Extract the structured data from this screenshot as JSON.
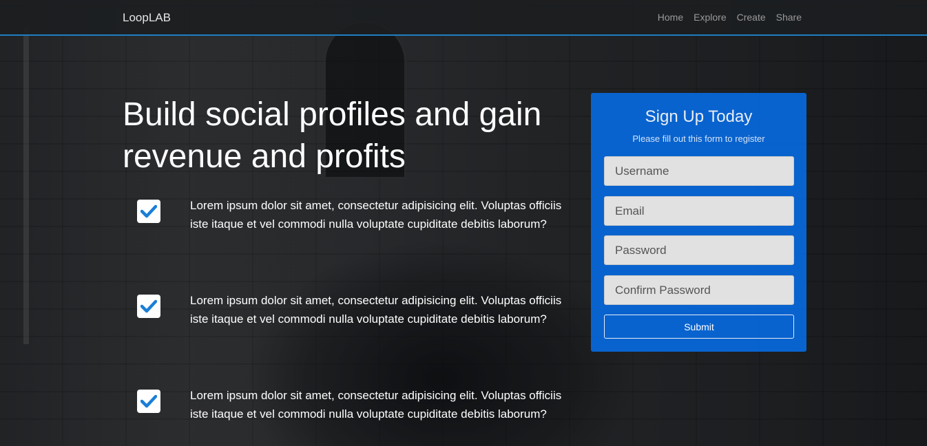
{
  "navbar": {
    "brand": "LoopLAB",
    "links": [
      "Home",
      "Explore",
      "Create",
      "Share"
    ]
  },
  "hero": {
    "title": "Build social profiles and gain revenue and profits",
    "features": [
      "Lorem ipsum dolor sit amet, consectetur adipisicing elit. Voluptas officiis iste itaque et vel commodi nulla voluptate cupiditate debitis laborum?",
      "Lorem ipsum dolor sit amet, consectetur adipisicing elit. Voluptas officiis iste itaque et vel commodi nulla voluptate cupiditate debitis laborum?",
      "Lorem ipsum dolor sit amet, consectetur adipisicing elit. Voluptas officiis iste itaque et vel commodi nulla voluptate cupiditate debitis laborum?"
    ]
  },
  "signup": {
    "title": "Sign Up Today",
    "subtitle": "Please fill out this form to register",
    "fields": {
      "username_placeholder": "Username",
      "email_placeholder": "Email",
      "password_placeholder": "Password",
      "confirm_placeholder": "Confirm Password"
    },
    "submit_label": "Submit"
  },
  "colors": {
    "accent": "#1f7fc4",
    "card": "#0768dc",
    "check": "#1a7ed6"
  }
}
